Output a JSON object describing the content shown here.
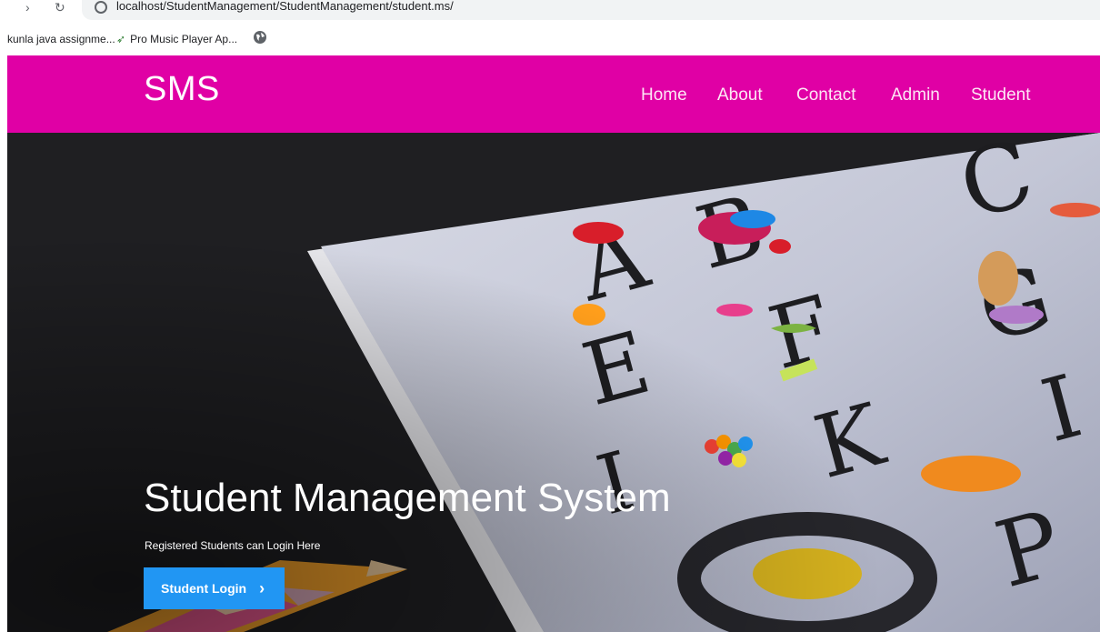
{
  "browser": {
    "url": "localhost/StudentManagement/StudentManagement/student.ms/",
    "bookmarks": [
      {
        "label": "kunla java assignme..."
      },
      {
        "label": "Pro Music Player Ap..."
      }
    ]
  },
  "header": {
    "brand": "SMS",
    "nav": {
      "home": "Home",
      "about": "About",
      "contact": "Contact",
      "admin": "Admin",
      "student": "Student"
    }
  },
  "hero": {
    "title": "Student Management System",
    "subtitle": "Registered Students can Login Here",
    "button_label": "Student Login",
    "button_icon": "chevron-right-icon"
  },
  "colors": {
    "header_bg": "#e000a5",
    "button_bg": "#2196f3",
    "hero_bg": "#1f1f22"
  }
}
